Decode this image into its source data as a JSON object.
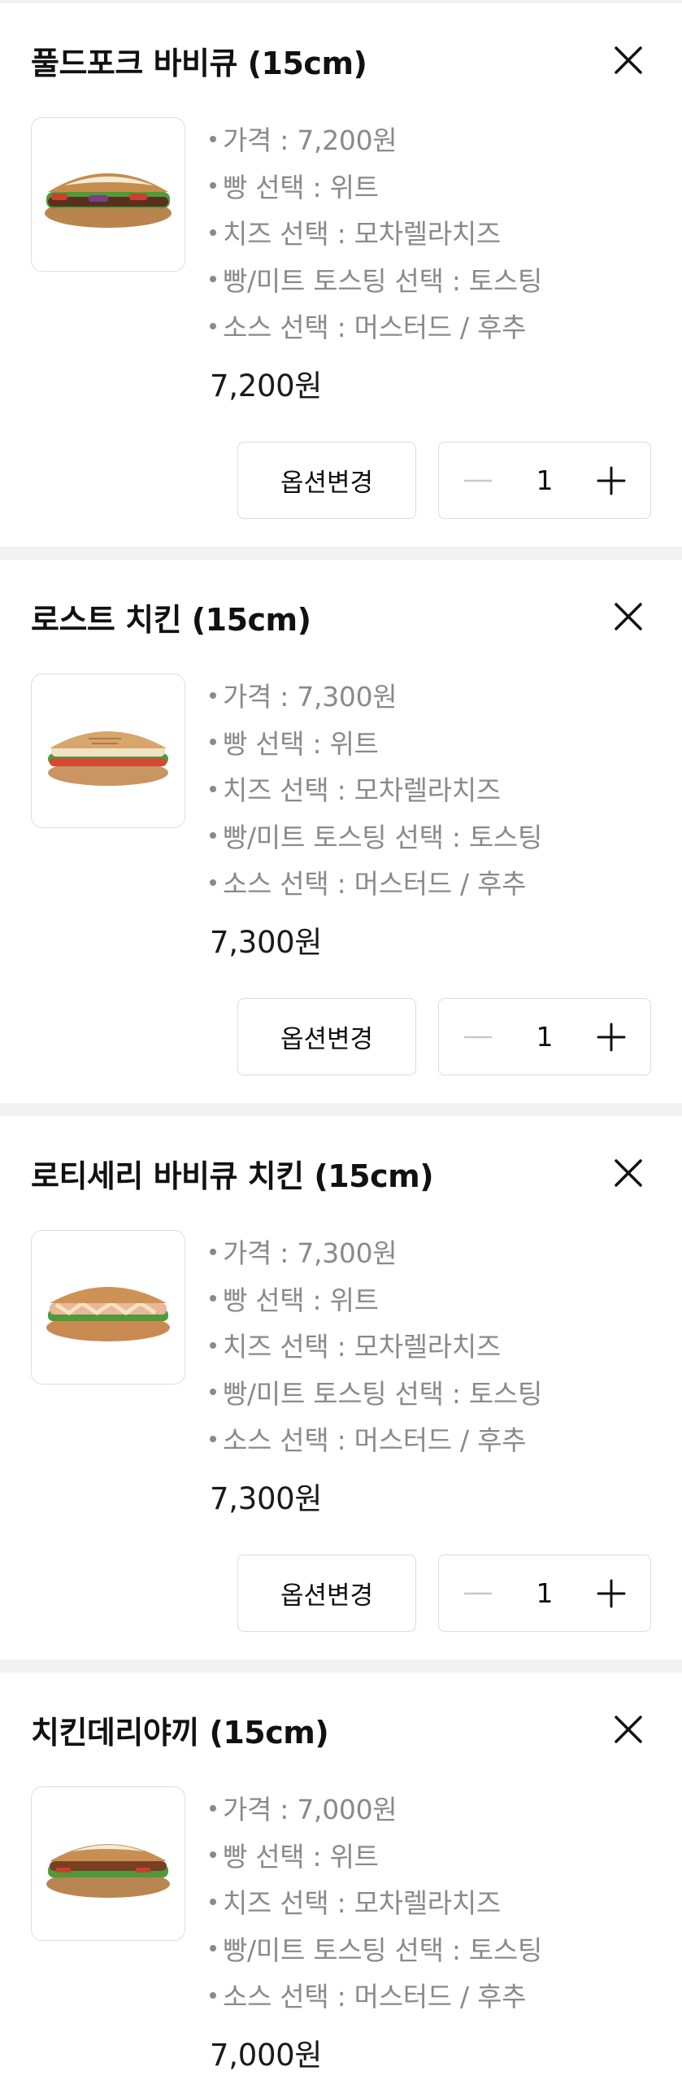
{
  "cart": {
    "items": [
      {
        "title": "풀드포크 바비큐 (15cm)",
        "options": [
          "가격 : 7,200원",
          "빵 선택 : 위트",
          "치즈 선택 : 모차렐라치즈",
          "빵/미트 토스팅 선택 : 토스팅",
          "소스 선택 : 머스터드 / 후추"
        ],
        "line_price": "7,200원",
        "change_label": "옵션변경",
        "quantity": "1",
        "image": "pulled-pork-sandwich"
      },
      {
        "title": "로스트 치킨 (15cm)",
        "options": [
          "가격 : 7,300원",
          "빵 선택 : 위트",
          "치즈 선택 : 모차렐라치즈",
          "빵/미트 토스팅 선택 : 토스팅",
          "소스 선택 : 머스터드 / 후추"
        ],
        "line_price": "7,300원",
        "change_label": "옵션변경",
        "quantity": "1",
        "image": "roast-chicken-sandwich"
      },
      {
        "title": "로티세리 바비큐 치킨 (15cm)",
        "options": [
          "가격 : 7,300원",
          "빵 선택 : 위트",
          "치즈 선택 : 모차렐라치즈",
          "빵/미트 토스팅 선택 : 토스팅",
          "소스 선택 : 머스터드 / 후추"
        ],
        "line_price": "7,300원",
        "change_label": "옵션변경",
        "quantity": "1",
        "image": "rotisserie-bbq-chicken-sandwich"
      },
      {
        "title": "치킨데리야끼 (15cm)",
        "options": [
          "가격 : 7,000원",
          "빵 선택 : 위트",
          "치즈 선택 : 모차렐라치즈",
          "빵/미트 토스팅 선택 : 토스팅",
          "소스 선택 : 머스터드 / 후추"
        ],
        "line_price": "7,000원",
        "image": "chicken-teriyaki-sandwich"
      }
    ]
  },
  "icons": {
    "remove": "close-icon",
    "decrease": "minus-icon",
    "increase": "plus-icon"
  },
  "colors": {
    "text_primary": "#111111",
    "text_secondary": "#8a8a8a",
    "border": "#dcdcdc",
    "disabled": "#c8c8c8"
  }
}
